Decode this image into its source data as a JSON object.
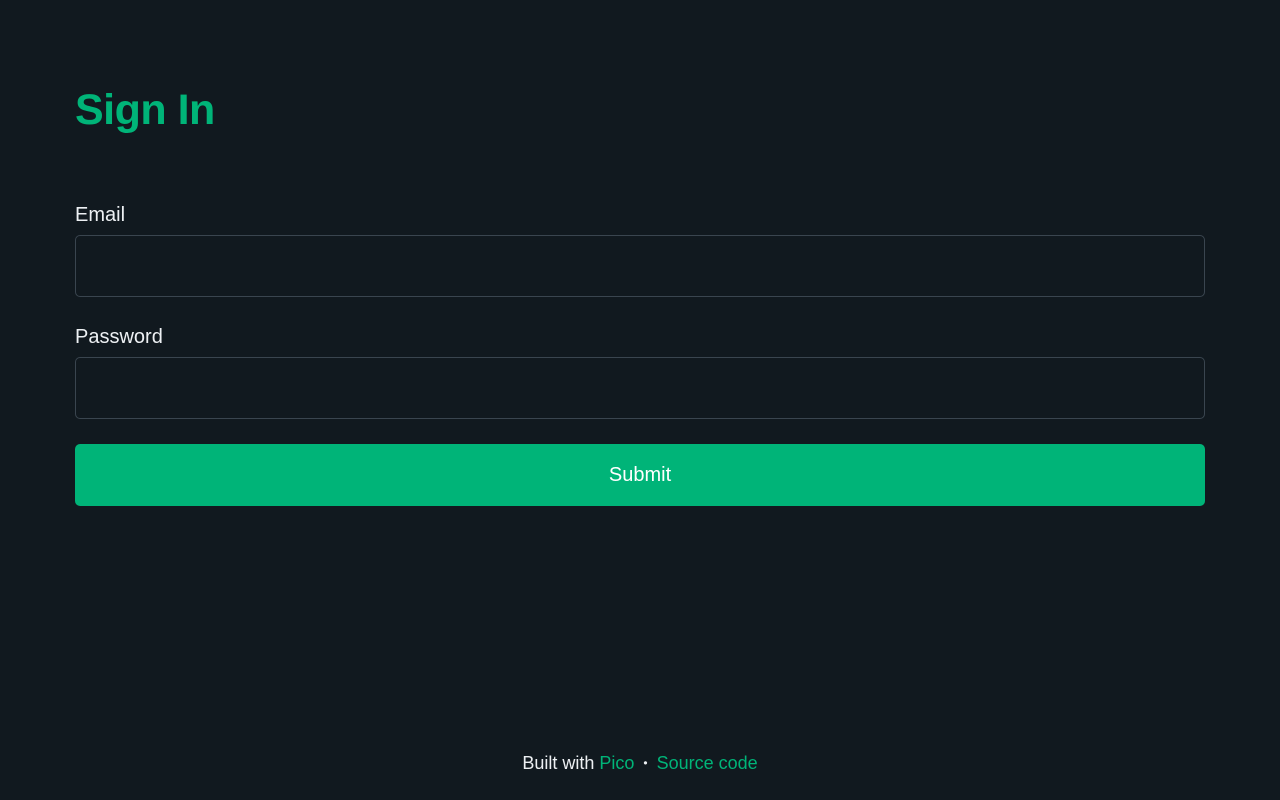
{
  "page": {
    "title": "Sign In",
    "accent_color": "#00b478",
    "background_color": "#11191f"
  },
  "form": {
    "email_label": "Email",
    "email_value": "",
    "password_label": "Password",
    "password_value": "",
    "submit_label": "Submit"
  },
  "footer": {
    "prefix": "Built with",
    "pico_link": "Pico",
    "separator": "•",
    "source_link": "Source code"
  }
}
